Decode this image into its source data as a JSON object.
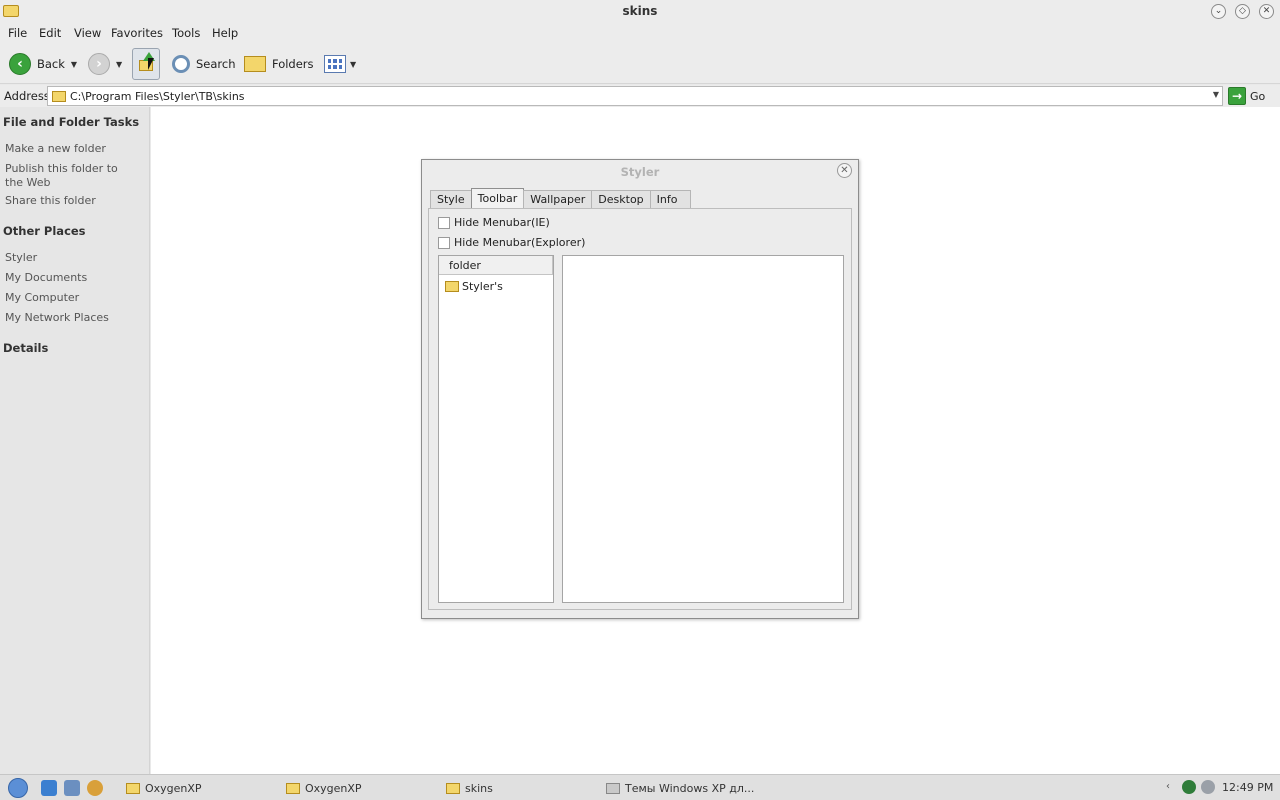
{
  "window": {
    "title": "skins"
  },
  "menubar": {
    "items": [
      "File",
      "Edit",
      "View",
      "Favorites",
      "Tools",
      "Help"
    ]
  },
  "toolbar": {
    "back_label": "Back",
    "search_label": "Search",
    "folders_label": "Folders"
  },
  "address": {
    "label": "Address",
    "value": "C:\\Program Files\\Styler\\TB\\skins",
    "go_label": "Go"
  },
  "sidebar": {
    "tasks_heading": "File and Folder Tasks",
    "tasks": [
      "Make a new folder",
      "Publish this folder to the Web",
      "Share this folder"
    ],
    "places_heading": "Other Places",
    "places": [
      "Styler",
      "My Documents",
      "My Computer",
      "My Network Places"
    ],
    "details_heading": "Details"
  },
  "dialog": {
    "title": "Styler",
    "tabs": [
      "Style",
      "Toolbar",
      "Wallpaper",
      "Desktop",
      "Info"
    ],
    "active_tab": "Toolbar",
    "checkboxes": [
      {
        "label": "Hide Menubar(IE)",
        "checked": false
      },
      {
        "label": "Hide Menubar(Explorer)",
        "checked": false
      }
    ],
    "tree_header": "folder",
    "tree_items": [
      "Styler's"
    ]
  },
  "taskbar": {
    "tasks": [
      "OxygenXP",
      "OxygenXP",
      "skins",
      "Темы Windows XP дл..."
    ],
    "active_task": "skins",
    "clock": "12:49 PM"
  },
  "colors": {
    "accent_green": "#3aa23c",
    "folder_yellow": "#f3d66b",
    "chrome_gray": "#ececec"
  },
  "icons": [
    "folder-icon",
    "back-arrow-icon",
    "forward-arrow-icon",
    "up-folder-icon",
    "search-icon",
    "folders-icon",
    "views-icon",
    "go-arrow-icon",
    "close-icon",
    "start-orb-icon"
  ]
}
